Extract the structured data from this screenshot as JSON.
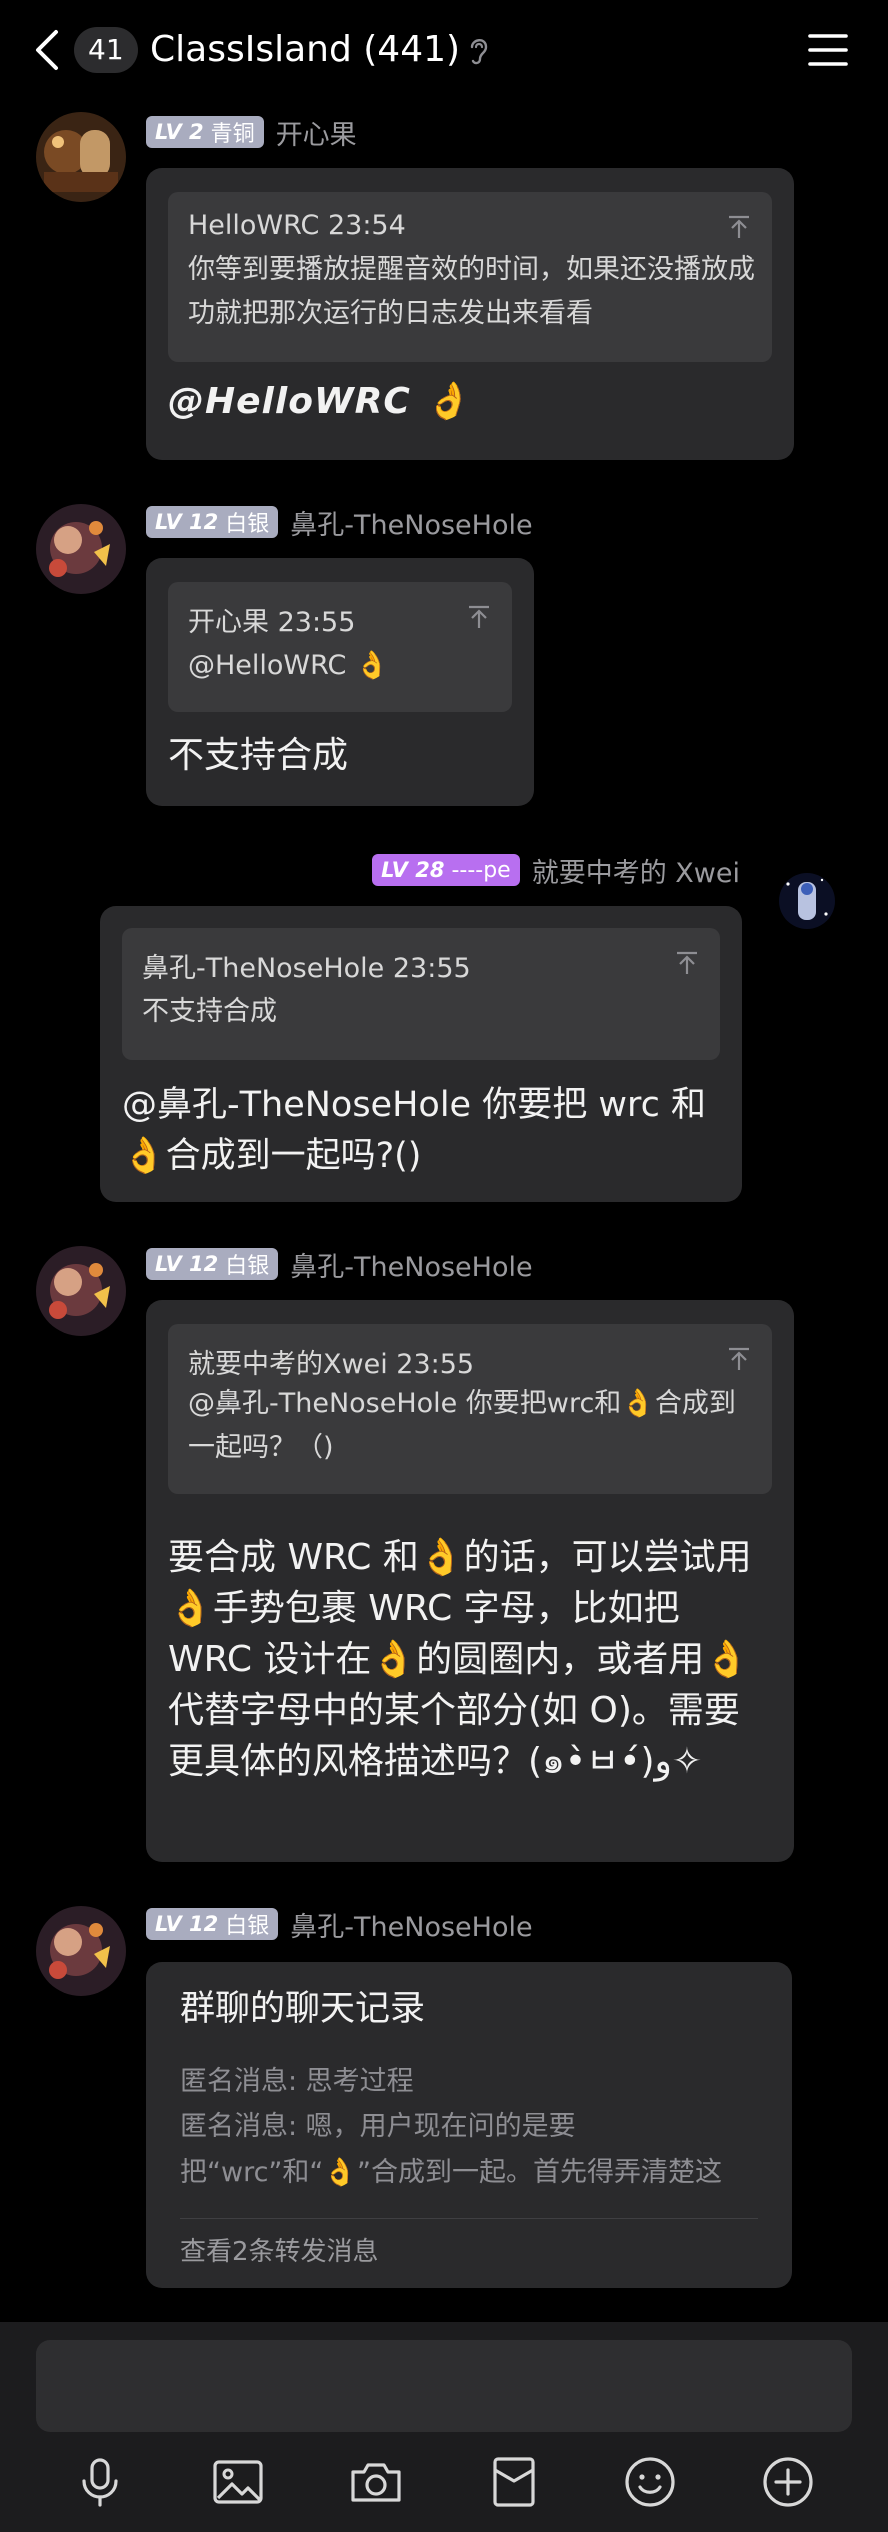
{
  "header": {
    "unread_count": "41",
    "title": "ClassIsland (441)"
  },
  "messages": [
    {
      "sender": "开心果",
      "level": "LV 2",
      "rank": "青铜",
      "quote": {
        "author_time": "HelloWRC 23:54",
        "text": "你等到要播放提醒音效的时间，如果还没播放成功就把那次运行的日志发出来看看"
      },
      "text": "@HelloWRC 👌"
    },
    {
      "sender": "鼻孔-TheNoseHole",
      "level": "LV 12",
      "rank": "白银",
      "quote": {
        "author_time": "开心果 23:55",
        "text": "@HelloWRC 👌"
      },
      "text": "不支持合成"
    },
    {
      "sender": "就要中考的 Xwei",
      "level": "LV 28",
      "rank": "----pe",
      "quote": {
        "author_time": "鼻孔-TheNoseHole 23:55",
        "text": "不支持合成"
      },
      "text": "@鼻孔-TheNoseHole 你要把 wrc 和👌合成到一起吗?()"
    },
    {
      "sender": "鼻孔-TheNoseHole",
      "level": "LV 12",
      "rank": "白银",
      "quote": {
        "author_time": "就要中考的Xwei 23:55",
        "text": "@鼻孔-TheNoseHole 你要把wrc和👌合成到一起吗？（)"
      },
      "text": "要合成 WRC 和👌的话，可以尝试用👌手势包裹 WRC 字母，比如把 WRC 设计在👌的圆圈内，或者用👌代替字母中的某个部分(如 O)。需要更具体的风格描述吗？(๑•̀ㅂ•́)و✧"
    },
    {
      "sender": "鼻孔-TheNoseHole",
      "level": "LV 12",
      "rank": "白银",
      "forward": {
        "title": "群聊的聊天记录",
        "line1": "匿名消息: 思考过程",
        "line2": "匿名消息: 嗯，用户现在问的是要把“wrc”和“👌”合成到一起。首先得弄清楚这两个符...",
        "footer": "查看2条转发消息"
      }
    }
  ],
  "icons": [
    "back-icon",
    "ear-icon",
    "menu-icon",
    "pin-icon",
    "microphone-icon",
    "image-icon",
    "camera-icon",
    "red-packet-icon",
    "emoji-icon",
    "plus-icon"
  ],
  "colors": {
    "background": "#000000",
    "bubble": "#2a2a2c",
    "quote": "#3a3a3c",
    "silver_badge": "#a9acbf",
    "purple_badge": "#b86ff0"
  }
}
